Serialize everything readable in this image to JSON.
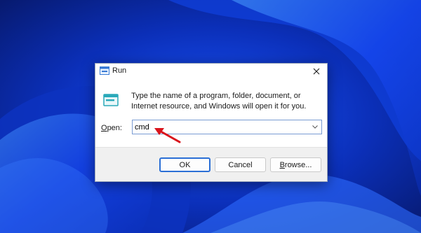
{
  "dialog": {
    "title": "Run",
    "title_icon": "run-icon",
    "close_icon": "close-icon",
    "content_icon": "run-icon",
    "description": "Type the name of a program, folder, document, or Internet resource, and Windows will open it for you.",
    "open_label_mnemonic": "O",
    "open_label_rest": "pen:",
    "open_value": "cmd",
    "dropdown_icon": "chevron-down-icon",
    "buttons": {
      "ok": "OK",
      "cancel": "Cancel",
      "browse_mnemonic": "B",
      "browse_rest": "rowse..."
    }
  },
  "annotation": {
    "arrow_icon": "red-arrow-icon",
    "arrow_color": "#d9141c"
  },
  "colors": {
    "accent": "#2b6fd6",
    "wallpaper": "#1038c8"
  }
}
